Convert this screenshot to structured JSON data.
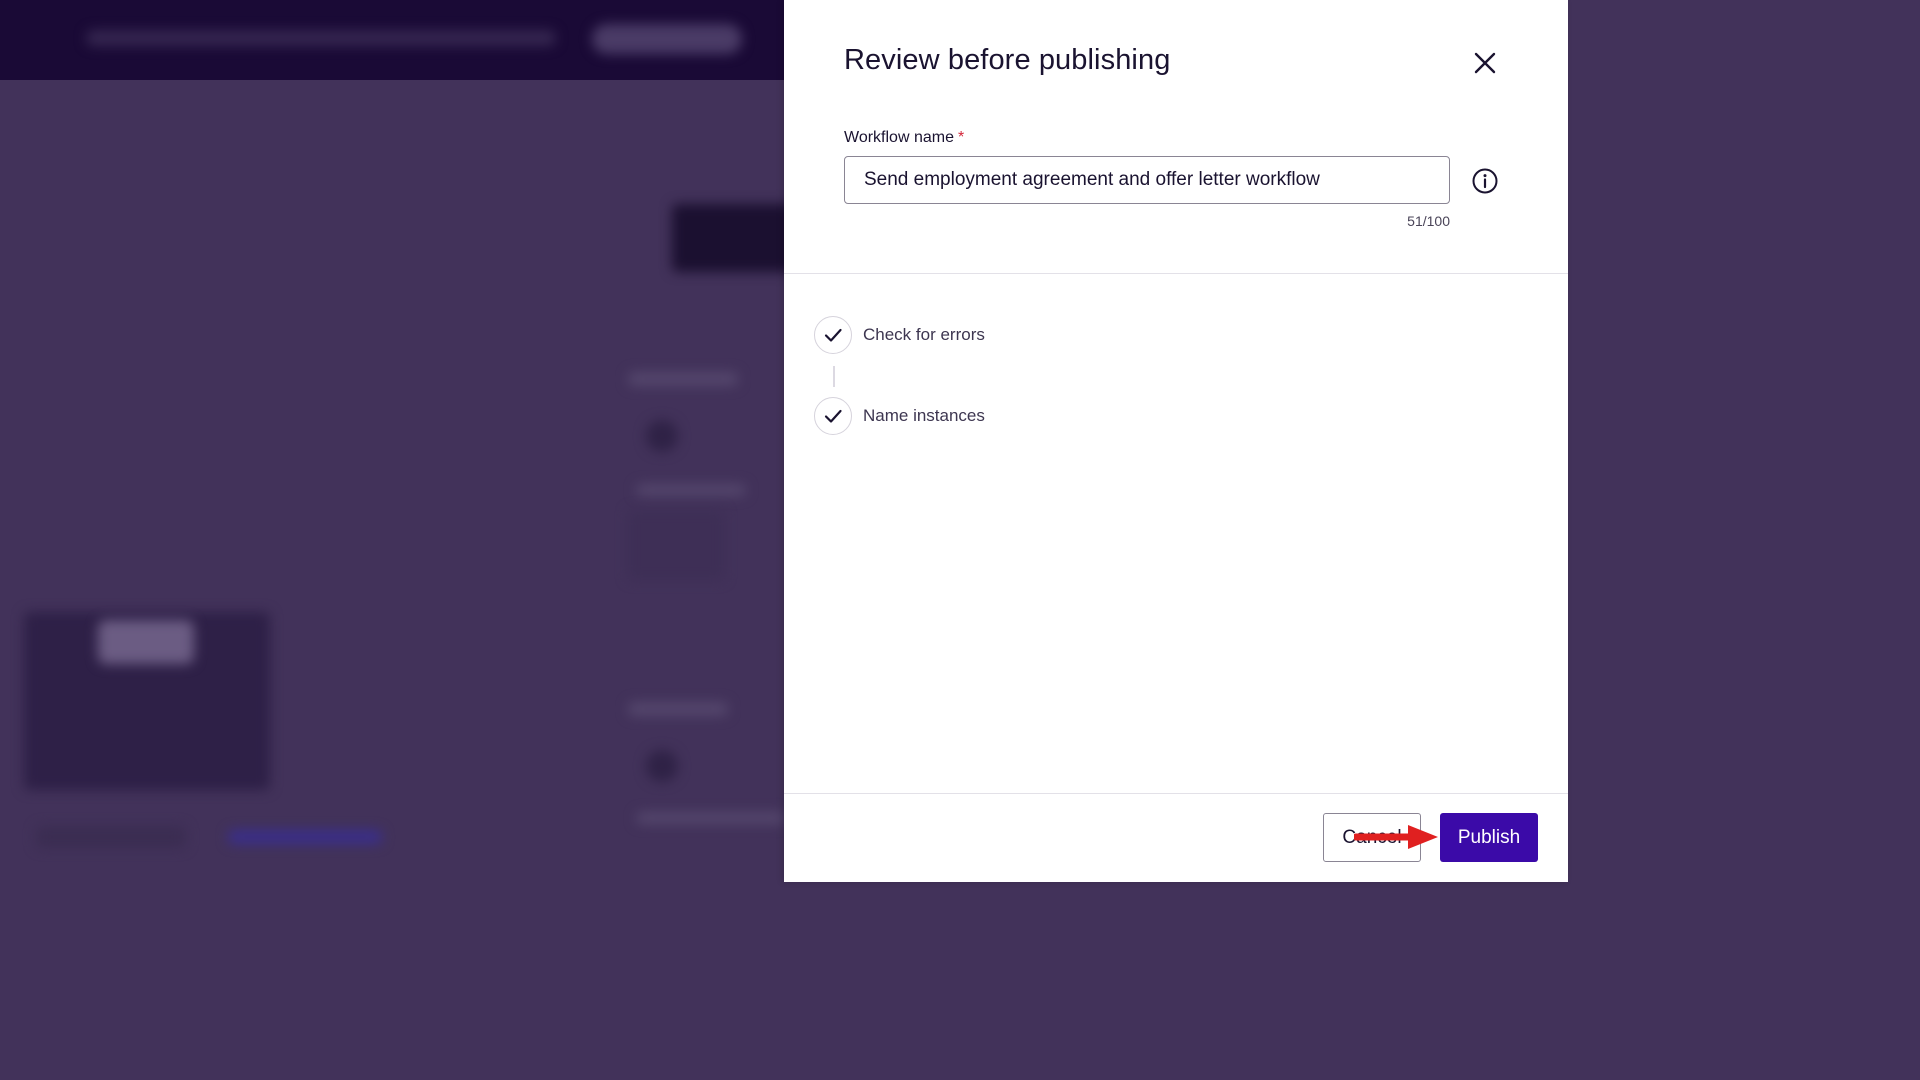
{
  "dialog": {
    "title": "Review before publishing",
    "close_icon": "close-icon",
    "workflow_name": {
      "label": "Workflow name",
      "required_marker": "*",
      "value": "Send employment agreement and offer letter workflow",
      "char_count": "51/100",
      "info_icon": "info-icon"
    },
    "steps": [
      {
        "label": "Check for errors",
        "status": "complete",
        "icon": "checkmark-icon"
      },
      {
        "label": "Name instances",
        "status": "complete",
        "icon": "checkmark-icon"
      }
    ],
    "footer": {
      "cancel_label": "Cancel",
      "publish_label": "Publish"
    }
  },
  "annotation": {
    "type": "red-arrow",
    "points_to": "publish-button",
    "color": "#e02020"
  },
  "colors": {
    "primary": "#3b0aa8",
    "required": "#d3263a",
    "overlay": "#42325a",
    "header_dark": "#1a0a36"
  }
}
